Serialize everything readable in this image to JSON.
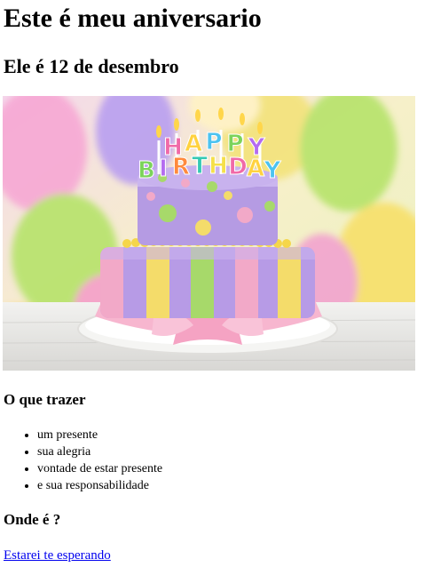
{
  "title": "Este é meu aniversario",
  "subtitle": "Ele é 12 de desembro",
  "image": {
    "banner_letters_top": [
      "H",
      "A",
      "P",
      "P",
      "Y"
    ],
    "banner_letters_bottom": [
      "B",
      "I",
      "R",
      "T",
      "H",
      "D",
      "A",
      "Y"
    ],
    "banner_colors": [
      "#f06aa8",
      "#ffd23f",
      "#4cc3f0",
      "#7bd35a",
      "#b46bf0",
      "#ff8a3d",
      "#36c9b3",
      "#f5e04a"
    ]
  },
  "what_to_bring": {
    "heading": "O que trazer",
    "items": [
      "um presente",
      "sua alegria",
      "vontade de estar presente",
      "e sua responsabilidade"
    ]
  },
  "where": {
    "heading": "Onde é ?",
    "link_text": "Estarei te esperando"
  }
}
